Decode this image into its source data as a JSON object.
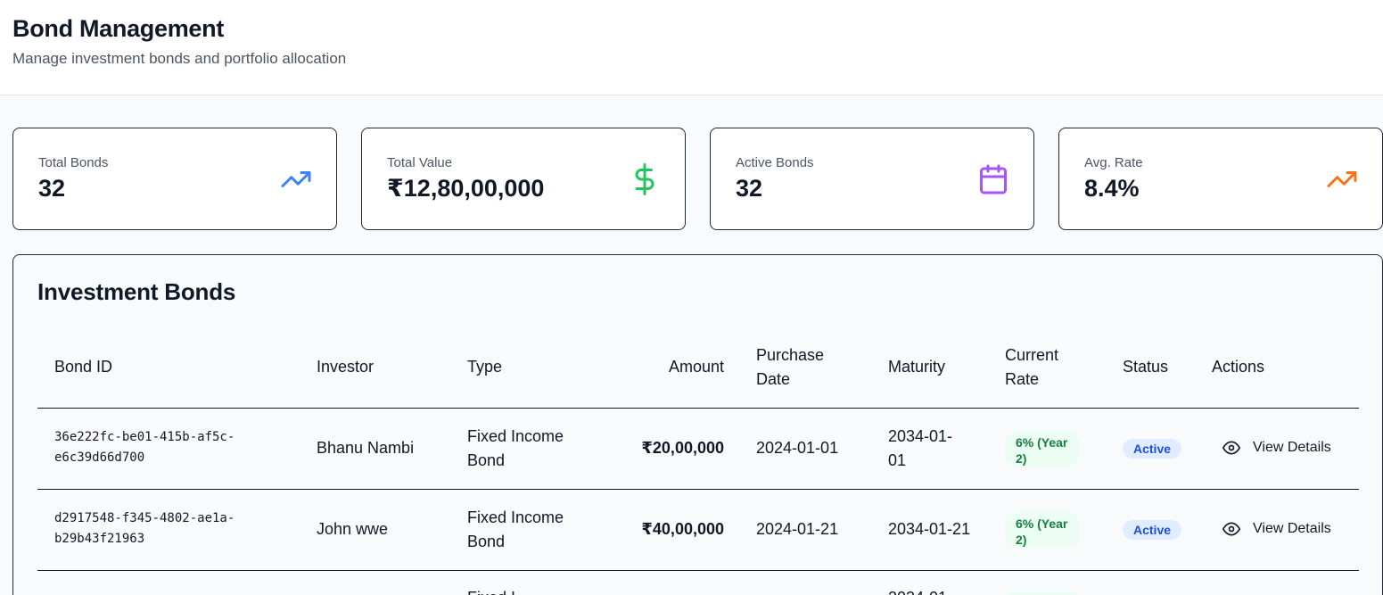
{
  "header": {
    "title": "Bond Management",
    "subtitle": "Manage investment bonds and portfolio allocation"
  },
  "stats": [
    {
      "label": "Total Bonds",
      "value": "32",
      "icon": "trending-up-icon",
      "color": "#3b82f6"
    },
    {
      "label": "Total Value",
      "value": "₹12,80,00,000",
      "icon": "dollar-icon",
      "color": "#22c55e"
    },
    {
      "label": "Active Bonds",
      "value": "32",
      "icon": "calendar-icon",
      "color": "#a855f7"
    },
    {
      "label": "Avg. Rate",
      "value": "8.4%",
      "icon": "trending-up-icon",
      "color": "#f97316"
    }
  ],
  "table": {
    "title": "Investment Bonds",
    "columns": {
      "bond_id": "Bond ID",
      "investor": "Investor",
      "type": "Type",
      "amount": "Amount",
      "purchase_date_1": "Purchase",
      "purchase_date_2": "Date",
      "maturity": "Maturity",
      "current_rate_1": "Current",
      "current_rate_2": "Rate",
      "status": "Status",
      "actions": "Actions"
    },
    "rows": [
      {
        "bond_id_1": "36e222fc-be01-415b-af5c-",
        "bond_id_2": "e6c39d66d700",
        "investor": "Bhanu Nambi",
        "type_1": "Fixed Income",
        "type_2": "Bond",
        "amount": "₹20,00,000",
        "purchase_date": "2024-01-01",
        "maturity_1": "2034-01-",
        "maturity_2": "01",
        "rate_1": "6% (Year",
        "rate_2": "2)",
        "status": "Active",
        "action": "View Details"
      },
      {
        "bond_id_1": "d2917548-f345-4802-ae1a-",
        "bond_id_2": "b29b43f21963",
        "investor": "John wwe",
        "type_1": "Fixed Income",
        "type_2": "Bond",
        "amount": "₹40,00,000",
        "purchase_date": "2024-01-21",
        "maturity_1": "2034-01-21",
        "maturity_2": "",
        "rate_1": "6% (Year",
        "rate_2": "2)",
        "status": "Active",
        "action": "View Details"
      },
      {
        "type_1": "Fixed I",
        "maturity_1": "2034-01-"
      }
    ]
  }
}
